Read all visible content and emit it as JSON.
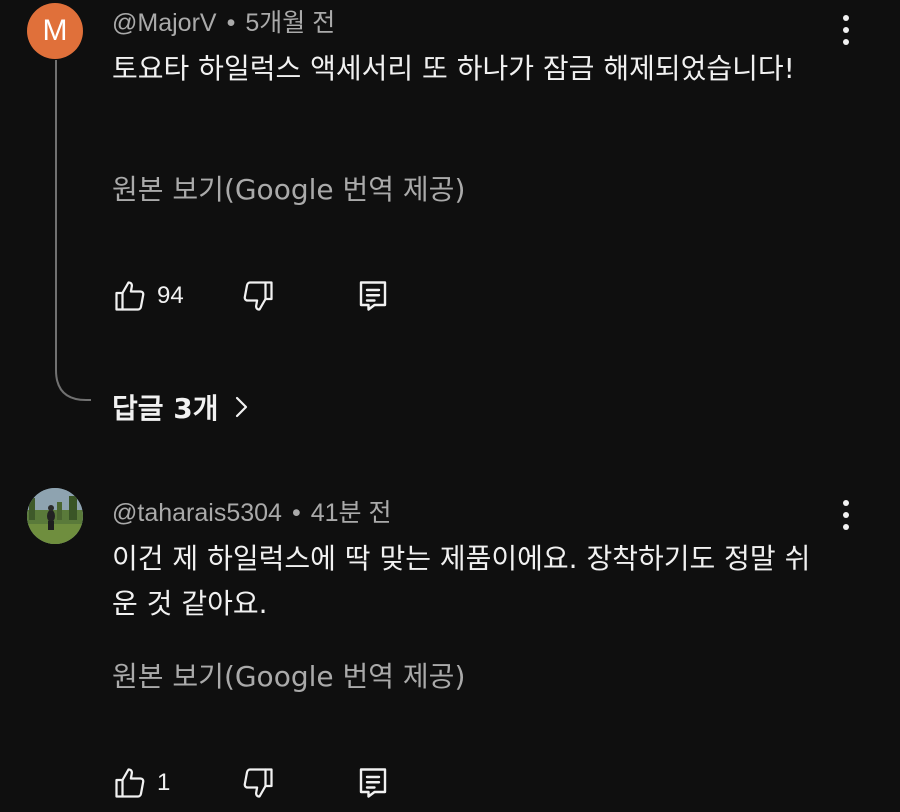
{
  "comments": [
    {
      "avatar_letter": "M",
      "avatar_color": "#e0703a",
      "author": "@MajorV",
      "time": "5개월 전",
      "text": "토요타 하일럭스 액세서리 또 하나가 잠금 해제되었습니다!",
      "translate_label": "원본 보기(Google 번역 제공)",
      "likes": "94",
      "replies_label": "답글 3개"
    },
    {
      "author": "@taharais5304",
      "time": "41분 전",
      "text": "이건 제 하일럭스에 딱 맞는 제품이에요. 장착하기도 정말 쉬운 것 같아요.",
      "translate_label": "원본 보기(Google 번역 제공)",
      "likes": "1"
    }
  ],
  "icons": {
    "like": "thumbs-up-icon",
    "dislike": "thumbs-down-icon",
    "reply": "reply-comment-icon",
    "more": "more-vertical-icon",
    "chevron": "chevron-right-icon"
  },
  "colors": {
    "background": "#0f0f0f",
    "primary_text": "#f1f1f1",
    "secondary_text": "#aaaaaa"
  }
}
